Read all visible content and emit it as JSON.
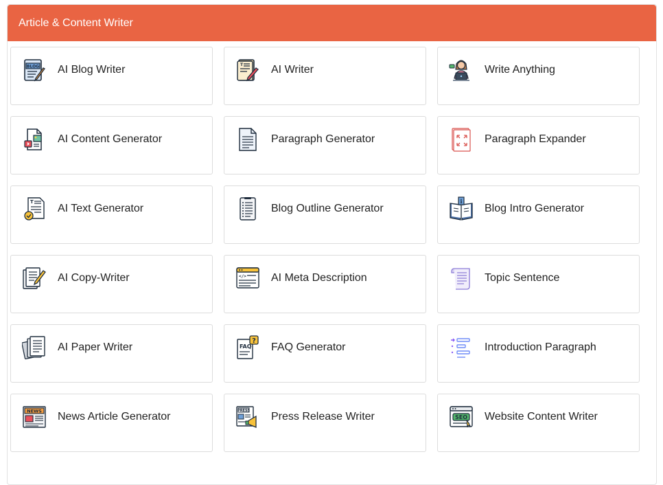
{
  "header": {
    "title": "Article & Content Writer"
  },
  "tools": [
    {
      "label": "AI Blog Writer",
      "icon": "blog-document-icon"
    },
    {
      "label": "AI Writer",
      "icon": "notebook-pen-icon"
    },
    {
      "label": "Write Anything",
      "icon": "person-laptop-icon"
    },
    {
      "label": "AI Content Generator",
      "icon": "content-files-icon"
    },
    {
      "label": "Paragraph Generator",
      "icon": "text-page-icon"
    },
    {
      "label": "Paragraph Expander",
      "icon": "expand-document-icon"
    },
    {
      "label": "AI Text Generator",
      "icon": "text-check-document-icon"
    },
    {
      "label": "Blog Outline Generator",
      "icon": "outline-list-icon"
    },
    {
      "label": "Blog Intro Generator",
      "icon": "open-book-icon"
    },
    {
      "label": "AI Copy-Writer",
      "icon": "copy-documents-pen-icon"
    },
    {
      "label": "AI Meta Description",
      "icon": "meta-browser-icon"
    },
    {
      "label": "Topic Sentence",
      "icon": "scroll-icon"
    },
    {
      "label": "AI Paper Writer",
      "icon": "paper-stack-icon"
    },
    {
      "label": "FAQ Generator",
      "icon": "faq-document-icon"
    },
    {
      "label": "Introduction Paragraph",
      "icon": "list-intro-icon"
    },
    {
      "label": "News Article Generator",
      "icon": "newspaper-icon"
    },
    {
      "label": "Press Release Writer",
      "icon": "press-megaphone-icon"
    },
    {
      "label": "Website Content Writer",
      "icon": "seo-browser-icon"
    }
  ]
}
